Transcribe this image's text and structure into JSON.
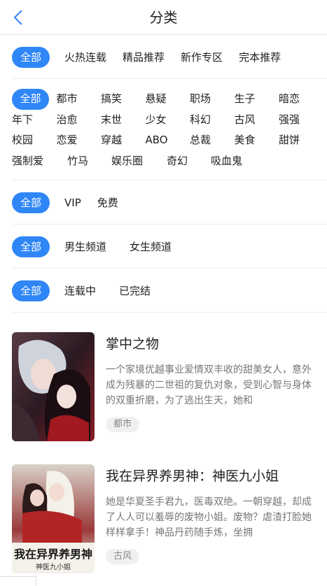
{
  "header": {
    "title": "分类",
    "back_icon": "chevron-left-icon",
    "accent": "#2f86f6"
  },
  "filters": {
    "section": [
      "全部",
      "火热连载",
      "精品推荐",
      "新作专区",
      "完本推荐"
    ],
    "tags": [
      "全部",
      "都市",
      "搞笑",
      "悬疑",
      "职场",
      "生子",
      "暗恋",
      "年下",
      "治愈",
      "末世",
      "少女",
      "科幻",
      "古风",
      "强强",
      "校园",
      "恋爱",
      "穿越",
      "ABO",
      "总裁",
      "美食",
      "甜饼",
      "强制爱",
      "竹马",
      "娱乐圈",
      "奇幻",
      "吸血鬼"
    ],
    "pay": [
      "全部",
      "VIP",
      "免费"
    ],
    "channel": [
      "全部",
      "男生频道",
      "女生频道"
    ],
    "status": [
      "全部",
      "连载中",
      "已完结"
    ]
  },
  "books": [
    {
      "title": "掌中之物",
      "desc": "一个家境优越事业爱情双丰收的甜美女人，意外成为残暴的二世祖的复仇对象，受到心智与身体的双重折磨，为了逃出生天，她和",
      "tag": "都市"
    },
    {
      "title": "我在异界养男神：神医九小姐",
      "desc": "她是华夏圣手君九，医毒双绝。一朝穿越，却成了人人可以羞辱的废物小姐。废物？虐渣打脸她样样拿手！神品丹药随手炼，坐拥",
      "tag": "古风",
      "cover_text": "我在异界养男神",
      "cover_subtext": "神医九小姐"
    }
  ]
}
